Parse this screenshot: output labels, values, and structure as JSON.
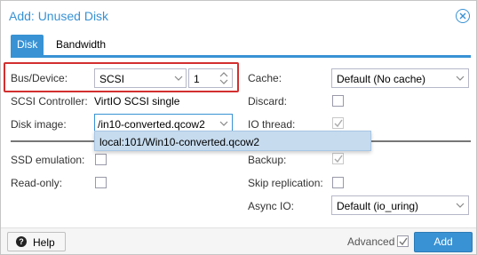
{
  "dialog": {
    "title": "Add: Unused Disk",
    "close_icon": "close-circle-icon",
    "accent": "#3892d4"
  },
  "tabs": [
    {
      "label": "Disk",
      "active": true
    },
    {
      "label": "Bandwidth",
      "active": false
    }
  ],
  "left": {
    "bus_device_label": "Bus/Device:",
    "bus_value": "SCSI",
    "device_number": "1",
    "scsi_controller_label": "SCSI Controller:",
    "scsi_controller_value": "VirtIO SCSI single",
    "disk_image_label": "Disk image:",
    "disk_image_value": "/in10-converted.qcow2",
    "disk_image_option": "local:101/Win10-converted.qcow2",
    "ssd_emulation_label": "SSD emulation:",
    "read_only_label": "Read-only:"
  },
  "right": {
    "cache_label": "Cache:",
    "cache_value": "Default (No cache)",
    "discard_label": "Discard:",
    "io_thread_label": "IO thread:",
    "backup_label": "Backup:",
    "skip_replication_label": "Skip replication:",
    "async_io_label": "Async IO:",
    "async_io_value": "Default (io_uring)"
  },
  "checkboxes": {
    "discard": false,
    "io_thread": true,
    "ssd_emulation": false,
    "backup": true,
    "read_only": false,
    "skip_replication": false,
    "advanced": true
  },
  "footer": {
    "help_label": "Help",
    "advanced_label": "Advanced",
    "add_label": "Add"
  },
  "highlight_color": "#d32f2f"
}
